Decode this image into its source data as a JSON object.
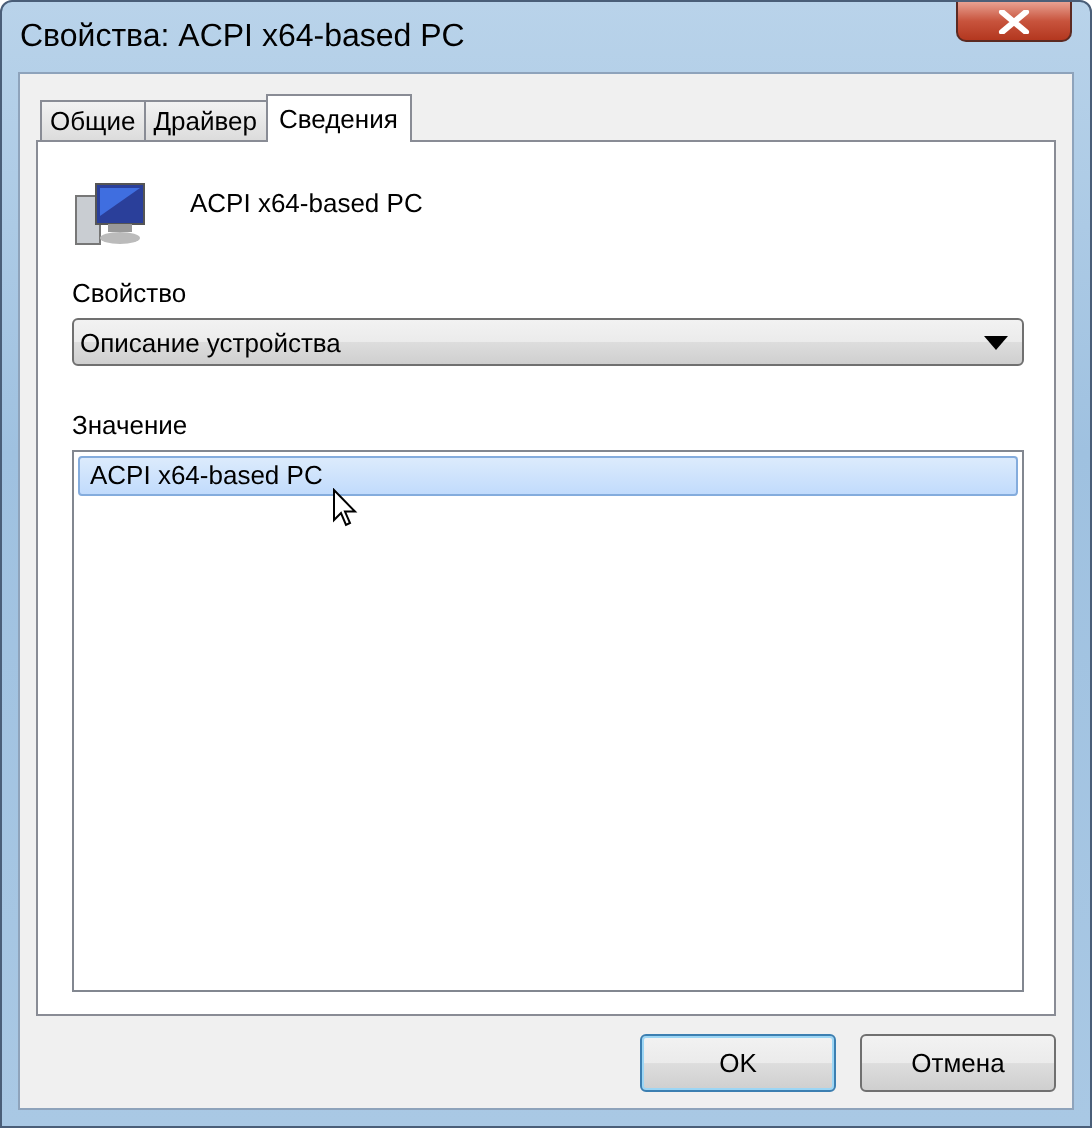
{
  "window": {
    "title": "Свойства: ACPI x64-based PC"
  },
  "tabs": [
    {
      "label": "Общие",
      "selected": false
    },
    {
      "label": "Драйвер",
      "selected": false
    },
    {
      "label": "Сведения",
      "selected": true
    }
  ],
  "device": {
    "name": "ACPI x64-based PC"
  },
  "property": {
    "label": "Свойство",
    "value": "Описание устройства"
  },
  "values": {
    "label": "Значение",
    "items": [
      {
        "text": "ACPI x64-based PC",
        "selected": true
      }
    ]
  },
  "buttons": [
    {
      "label": "OK",
      "focused": true
    },
    {
      "label": "Отмена",
      "focused": false
    }
  ]
}
